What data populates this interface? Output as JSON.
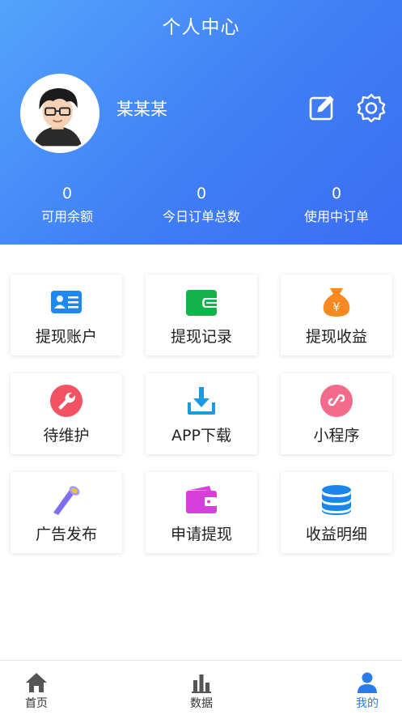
{
  "header": {
    "title": "个人中心",
    "username": "某某某",
    "edit_icon": "edit-icon",
    "settings_icon": "gear-icon"
  },
  "stats": [
    {
      "value": "0",
      "label": "可用余额"
    },
    {
      "value": "0",
      "label": "今日订单总数"
    },
    {
      "value": "0",
      "label": "使用中订单"
    }
  ],
  "menu": [
    {
      "label": "提现账户",
      "icon": "id-card-icon",
      "color": "#1e88f5"
    },
    {
      "label": "提现记录",
      "icon": "wallet-icon",
      "color": "#12b34a"
    },
    {
      "label": "提现收益",
      "icon": "money-bag-icon",
      "color": "#f6891f"
    },
    {
      "label": "待维护",
      "icon": "wrench-icon",
      "color": "#f25263"
    },
    {
      "label": "APP下载",
      "icon": "download-icon",
      "color": "#1a9ae0"
    },
    {
      "label": "小程序",
      "icon": "mini-program-icon",
      "color": "#f26b8a"
    },
    {
      "label": "广告发布",
      "icon": "telescope-icon",
      "color": "#7d6ff0"
    },
    {
      "label": "申请提现",
      "icon": "purse-icon",
      "color": "#d63fd9"
    },
    {
      "label": "收益明细",
      "icon": "database-icon",
      "color": "#1a87e8"
    }
  ],
  "tabs": [
    {
      "label": "首页",
      "icon": "home-icon"
    },
    {
      "label": "数据",
      "icon": "bar-chart-icon"
    },
    {
      "label": "我的",
      "icon": "user-icon",
      "active": true
    }
  ],
  "colors": {
    "header_gradient_start": "#54a3fb",
    "header_gradient_end": "#3a6ef3",
    "active_tab": "#2b7ce9"
  }
}
